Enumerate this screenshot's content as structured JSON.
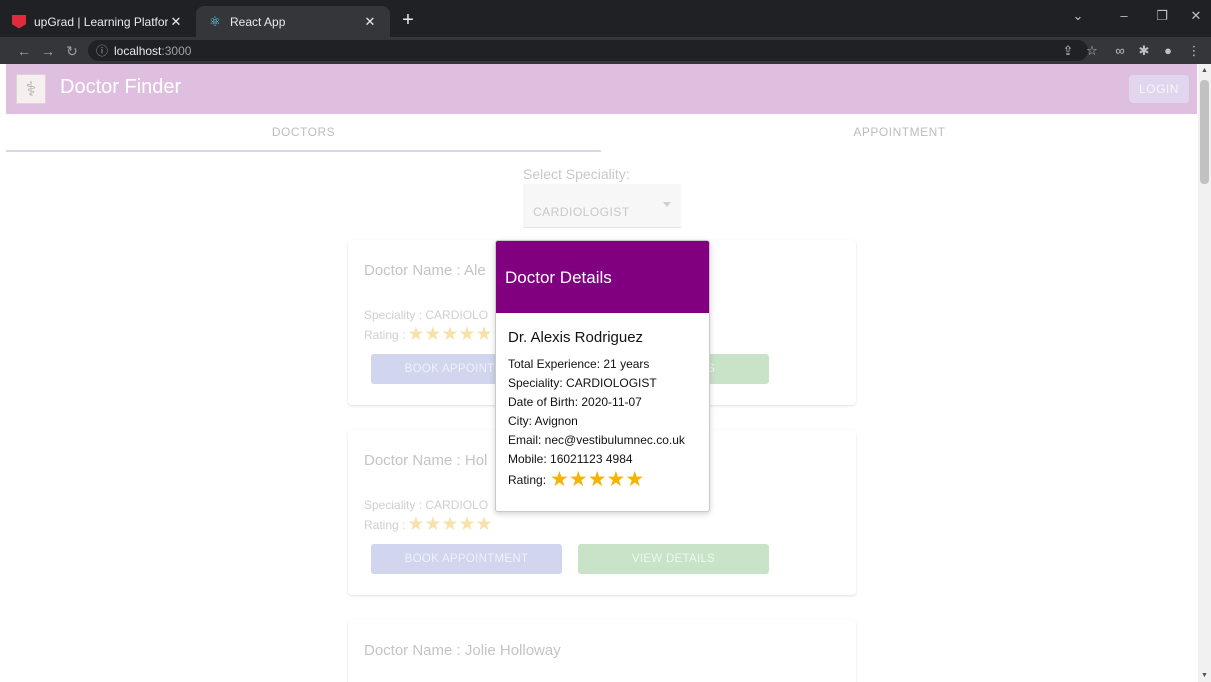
{
  "browser": {
    "tabs": [
      {
        "label": "upGrad | Learning Platform",
        "active": false
      },
      {
        "label": "React App",
        "active": true
      }
    ],
    "url": {
      "host": "localhost",
      "port": ":3000"
    }
  },
  "app": {
    "title": "Doctor Finder",
    "login_label": "LOGIN",
    "tabs": [
      {
        "label": "DOCTORS",
        "selected": true
      },
      {
        "label": "APPOINTMENT",
        "selected": false
      }
    ],
    "speciality": {
      "label": "Select Speciality:",
      "selected": "CARDIOLOGIST"
    },
    "book_label": "BOOK APPOINTMENT",
    "view_label": "VIEW DETAILS",
    "cards": [
      {
        "name": "Doctor Name : Ale",
        "speciality": "Speciality : CARDIOLO",
        "rating_label": "Rating :",
        "rating": 5
      },
      {
        "name": "Doctor Name : Hol",
        "speciality": "Speciality : CARDIOLO",
        "rating_label": "Rating :",
        "rating": 5
      },
      {
        "name": "Doctor Name : Jolie Holloway"
      }
    ]
  },
  "modal": {
    "title": "Doctor Details",
    "doctor_name": "Dr. Alexis Rodriguez",
    "experience": "Total Experience: 21 years",
    "speciality": "Speciality: CARDIOLOGIST",
    "dob": "Date of Birth: 2020-11-07",
    "city": "City: Avignon",
    "email": "Email: nec@vestibulumnec.co.uk",
    "mobile": "Mobile: 16021123 4984",
    "rating_label": "Rating:",
    "rating": 5
  },
  "colors": {
    "appbar": "#dfbfdf",
    "modal_header": "#800080",
    "star": "#f5b400"
  }
}
